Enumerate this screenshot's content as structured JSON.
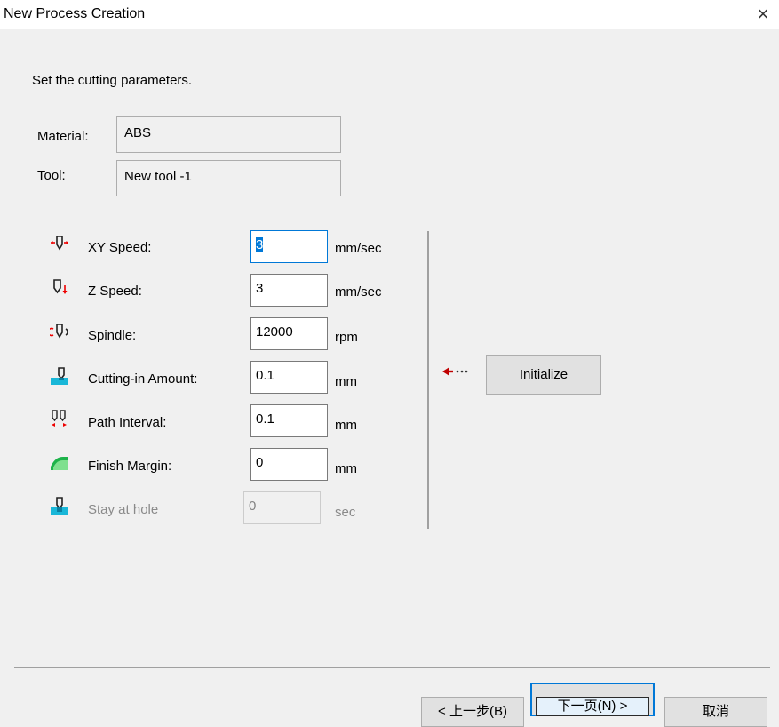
{
  "window": {
    "title": "New Process Creation",
    "close_label": "×"
  },
  "instruction": "Set the cutting parameters.",
  "material": {
    "label": "Material:",
    "value": "ABS"
  },
  "tool": {
    "label": "Tool:",
    "value": "New tool -1"
  },
  "params": [
    {
      "label": "XY Speed:",
      "value": "3",
      "unit": "mm/sec",
      "icon": "xy-speed-icon"
    },
    {
      "label": "Z Speed:",
      "value": "3",
      "unit": "mm/sec",
      "icon": "z-speed-icon"
    },
    {
      "label": "Spindle:",
      "value": "12000",
      "unit": "rpm",
      "icon": "spindle-icon"
    },
    {
      "label": "Cutting-in Amount:",
      "value": "0.1",
      "unit": "mm",
      "icon": "cutting-in-icon"
    },
    {
      "label": "Path Interval:",
      "value": "0.1",
      "unit": "mm",
      "icon": "path-interval-icon"
    },
    {
      "label": "Finish Margin:",
      "value": "0",
      "unit": "mm",
      "icon": "finish-margin-icon"
    },
    {
      "label": "Stay at hole",
      "value": "0",
      "unit": "sec",
      "icon": "stay-at-hole-icon"
    }
  ],
  "initialize": {
    "label": "Initialize"
  },
  "buttons": {
    "back": "< 上一步(B)",
    "next": "下一页(N) >",
    "cancel": "取消"
  }
}
